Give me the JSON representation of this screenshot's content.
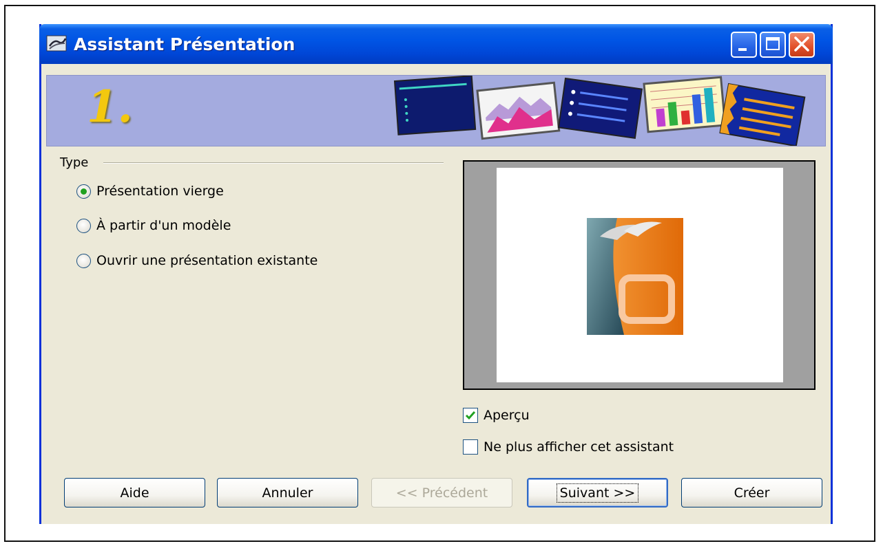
{
  "window": {
    "title": "Assistant Présentation",
    "step_number": "1."
  },
  "type_group": {
    "label": "Type",
    "options": [
      {
        "label": "Présentation vierge",
        "selected": true
      },
      {
        "label": "À partir d'un modèle",
        "selected": false
      },
      {
        "label": "Ouvrir une présentation existante",
        "selected": false
      }
    ]
  },
  "checkboxes": {
    "preview": {
      "label": "Aperçu",
      "checked": true
    },
    "dont_show": {
      "label": "Ne plus afficher cet assistant",
      "checked": false
    }
  },
  "buttons": {
    "help": "Aide",
    "cancel": "Annuler",
    "previous": "<< Précédent",
    "next": "Suivant >>",
    "create": "Créer"
  },
  "icons": {
    "title": "impress-icon",
    "preview": "openoffice-impress-logo"
  }
}
